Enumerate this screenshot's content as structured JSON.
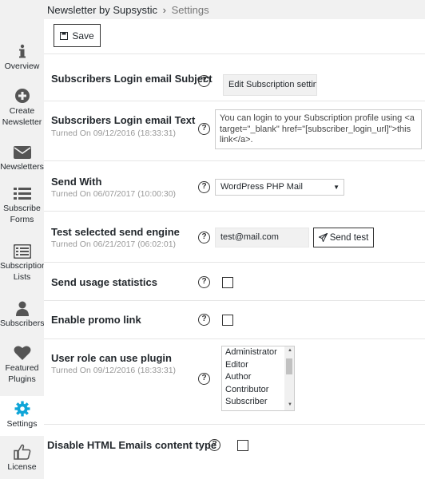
{
  "breadcrumb": {
    "plugin": "Newsletter by Supsystic",
    "separator": "›",
    "current": "Settings"
  },
  "sidebar": {
    "items": [
      {
        "label1": "Overview",
        "label2": "",
        "icon": "info-icon"
      },
      {
        "label1": "Create",
        "label2": "Newsletter",
        "icon": "plus-circle-icon"
      },
      {
        "label1": "Newsletters",
        "label2": "",
        "icon": "envelope-icon"
      },
      {
        "label1": "Subscribe",
        "label2": "Forms",
        "icon": "list-icon"
      },
      {
        "label1": "Subscription",
        "label2": "Lists",
        "icon": "list-alt-icon"
      },
      {
        "label1": "Subscribers",
        "label2": "",
        "icon": "user-icon"
      },
      {
        "label1": "Featured",
        "label2": "Plugins",
        "icon": "heart-icon"
      },
      {
        "label1": "Settings",
        "label2": "",
        "icon": "gear-icon",
        "active": true
      },
      {
        "label1": "License",
        "label2": "",
        "icon": "thumbs-up-icon"
      }
    ]
  },
  "toolbar": {
    "save_label": "Save"
  },
  "settings": {
    "login_subject": {
      "label": "Subscribers Login email Subject",
      "value": "Edit Subscription settin"
    },
    "login_text": {
      "label": "Subscribers Login email Text",
      "subtitle": "Turned On 09/12/2016 (18:33:31)",
      "value": "You can login to your Subscription profile using <a target=\"_blank\" href=\"[subscriber_login_url]\">this link</a>."
    },
    "send_with": {
      "label": "Send With",
      "subtitle": "Turned On 06/07/2017 (10:00:30)",
      "value": "WordPress PHP Mail"
    },
    "test_engine": {
      "label": "Test selected send engine",
      "subtitle": "Turned On 06/21/2017 (06:02:01)",
      "email": "test@mail.com",
      "button": "Send test"
    },
    "usage_stats": {
      "label": "Send usage statistics",
      "checked": false
    },
    "promo_link": {
      "label": "Enable promo link",
      "checked": false
    },
    "user_role": {
      "label": "User role can use plugin",
      "subtitle": "Turned On 09/12/2016 (18:33:31)",
      "options": [
        "Administrator",
        "Editor",
        "Author",
        "Contributor",
        "Subscriber"
      ]
    },
    "disable_html": {
      "label": "Disable HTML Emails content type",
      "checked": false
    }
  },
  "help_symbol": "?",
  "colors": {
    "accent": "#0073aa",
    "panel": "#ffffff",
    "sidebar": "#f1f1f1",
    "text": "#23282d",
    "muted": "#999999"
  }
}
